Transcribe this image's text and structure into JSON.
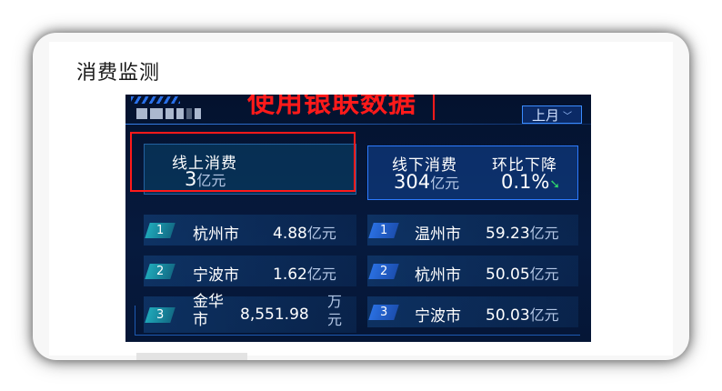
{
  "card": {
    "title": "消费监测"
  },
  "annotation": "使用银联数据",
  "period": {
    "label": "上月",
    "icon": "chevron-down-icon"
  },
  "online": {
    "label": "线上消费",
    "value": "3",
    "unit": "亿元"
  },
  "offline": {
    "label": "线下消费",
    "value": "304",
    "unit": "亿元",
    "change_label": "环比下降",
    "change_value": "0.1%",
    "change_icon": "arrow-down-icon",
    "change_color": "#2fd36b"
  },
  "online_ranking": [
    {
      "rank": "1",
      "city": "杭州市",
      "value": "4.88",
      "unit": "亿元"
    },
    {
      "rank": "2",
      "city": "宁波市",
      "value": "1.62",
      "unit": "亿元"
    },
    {
      "rank": "3",
      "city_line1": "金华",
      "city_line2": "市",
      "value": "8,551.98",
      "unit_line1": "万",
      "unit_line2": "元"
    }
  ],
  "offline_ranking": [
    {
      "rank": "1",
      "city": "温州市",
      "value": "59.23",
      "unit": "亿元"
    },
    {
      "rank": "2",
      "city": "杭州市",
      "value": "50.05",
      "unit": "亿元"
    },
    {
      "rank": "3",
      "city": "宁波市",
      "value": "50.03",
      "unit": "亿元"
    }
  ],
  "colors": {
    "annotation": "#ff1a1a",
    "panel_bg": "#04122e",
    "accent": "#2d7bff",
    "unit_text": "#b5c8e6"
  }
}
